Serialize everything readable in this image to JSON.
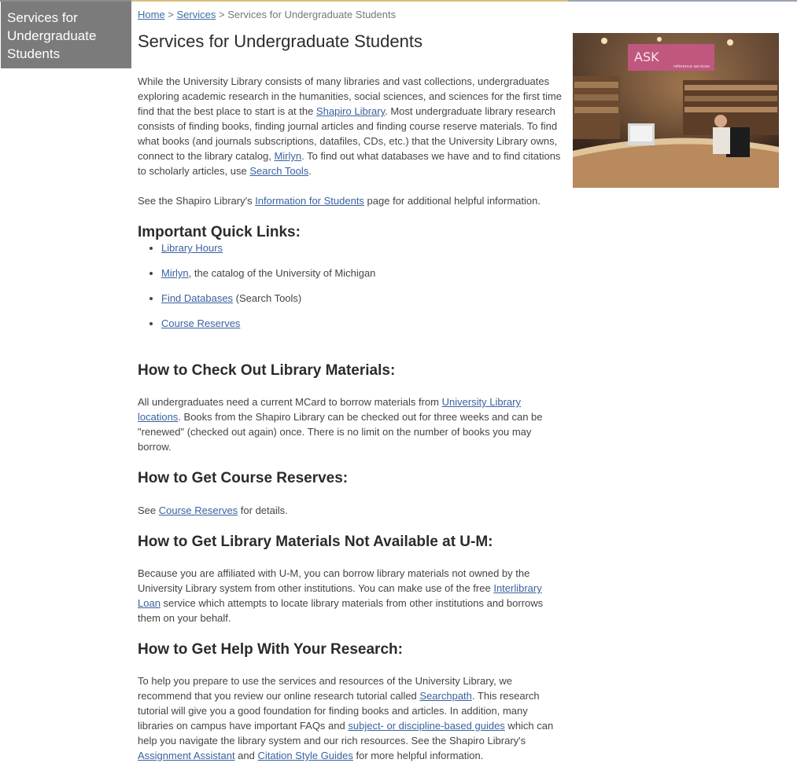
{
  "sidebar": {
    "title": "Services for Undergraduate Students"
  },
  "breadcrumb": {
    "home": "Home",
    "sep1": " > ",
    "services": "Services",
    "sep2": " > ",
    "current": "Services for Undergraduate Students"
  },
  "page_title": "Services for Undergraduate Students",
  "intro": {
    "t1": "While the University Library consists of many libraries and vast collections, undergraduates exploring academic research in the humanities, social sciences, and sciences for the first time find that the best place to start is at the ",
    "link_shapiro": "Shapiro Library",
    "t2": ". Most undergraduate library research consists of finding books, finding journal articles and finding course reserve materials. To find what books (and journals subscriptions, datafiles, CDs, etc.) that the University Library owns, connect to the library catalog, ",
    "link_mirlyn": "Mirlyn",
    "t3": ". To find out what databases we have and to find citations to scholarly articles, use ",
    "link_search_tools": "Search Tools",
    "t4": "."
  },
  "info_para": {
    "t1": "See the Shapiro Library's ",
    "link": "Information for Students",
    "t2": " page for additional helpful information."
  },
  "quick_links": {
    "heading": "Important Quick Links:",
    "items": [
      {
        "link": "Library Hours",
        "rest": ""
      },
      {
        "link": "Mirlyn",
        "rest": ", the catalog of the University of Michigan"
      },
      {
        "link": "Find Databases",
        "rest": " (Search Tools)"
      },
      {
        "link": "Course Reserves",
        "rest": ""
      }
    ]
  },
  "checkout": {
    "heading": "How to Check Out Library Materials:",
    "t1": "All undergraduates need a current MCard to borrow materials from ",
    "link": "University Library locations",
    "t2": ". Books from the Shapiro Library can be checked out for three weeks and can be \"renewed\" (checked out again) once. There is no limit on the number of books you may borrow."
  },
  "reserves": {
    "heading": "How to Get Course Reserves:",
    "t1": "See ",
    "link": "Course Reserves",
    "t2": " for details."
  },
  "not_available": {
    "heading": "How to Get Library Materials Not Available at U-M:",
    "t1": "Because you are affiliated with U-M, you can borrow library materials not owned by the University Library system from other institutions. You can make use of the free ",
    "link": "Interlibrary Loan",
    "t2": " service which attempts to locate library materials from other institutions and borrows them on your behalf."
  },
  "help": {
    "heading": "How to Get Help With Your Research:",
    "t1": "To help you prepare to use the services and resources of the University Library, we recommend that you review our online research tutorial called ",
    "link_searchpath": "Searchpath",
    "t2": ". This research tutorial will give you a good foundation for finding books and articles. In addition, many libraries on campus have important FAQs and ",
    "link_guides": "subject- or discipline-based guides",
    "t3": " which can help you navigate the library system and our rich resources. See the Shapiro Library's ",
    "link_assignment": "Assignment Assistant",
    "t4": " and ",
    "link_citation": "Citation Style Guides",
    "t5": " for more helpful information."
  },
  "photo": {
    "sign_text": "ASK",
    "sign_sub": "reference services"
  },
  "colors": {
    "link": "#3a62a0",
    "sidebar_bg": "#7b7b7b",
    "sign": "#c0577e"
  }
}
